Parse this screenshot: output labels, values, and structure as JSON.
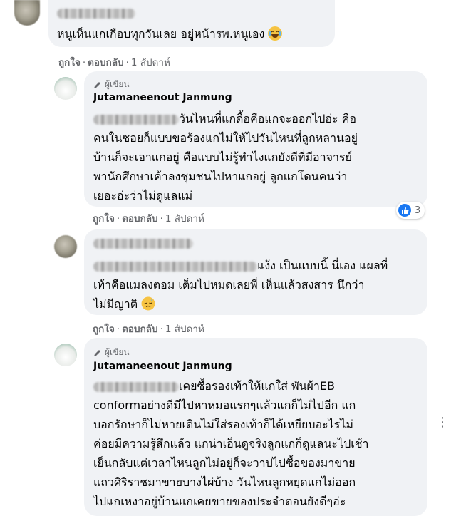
{
  "comments": [
    {
      "text": "หนูเห็นแกเกือบทุกวันเลย อยู่หน้ารพ.หนูเอง",
      "emoji": "laughing-crying-emoji",
      "actions": {
        "like": "ถูกใจ",
        "reply": "ตอบกลับ",
        "time": "1 สัปดาห์"
      }
    },
    {
      "badge": "ผู้เขียน",
      "author": "Jutamaneenout Janmung",
      "lines": [
        "วันไหนที่แกดื้อคือแกจะออกไปอ่ะ คือ",
        "คนในซอยก็แบบขอร้องแกไม่ให้ไปวันไหนที่ลูกหลานอยู่",
        "บ้านก็จะเอาแกอยู่ คือแบบไม่รู้ทำไงแกยังดีที่มีอาจารย์",
        "พานักศึกษาเค้าลงชุมชนไปหาแกอยู่ ลูกแกโดนคนว่า",
        "เยอะอ่ะว่าไม่ดูแลแม่"
      ],
      "reaction_count": "3",
      "actions": {
        "like": "ถูกใจ",
        "reply": "ตอบกลับ",
        "time": "1 สัปดาห์"
      }
    },
    {
      "lines": [
        "แง้ง เป็นแบบนี้ นี่เอง แผลที่",
        "เท้าคือแมลงตอม เต็มไปหมดเลยพี่ เห็นแล้วสงสาร นึกว่า",
        "ไม่มีญาติ"
      ],
      "emoji": "sad-sweat-emoji",
      "actions": {
        "like": "ถูกใจ",
        "reply": "ตอบกลับ",
        "time": "1 สัปดาห์"
      }
    },
    {
      "badge": "ผู้เขียน",
      "author": "Jutamaneenout Janmung",
      "lines": [
        "เคยซื้อรองเท้าให้แกใส่ พันผ้าEB",
        "conformอย่างดีมีไปหาหมอแรกๆแล้วแกก็ไม่ไปอีก แก",
        "บอกรักษาก็ไม่หายเดินไม่ใส่รองเท้าก็ได้เหยียบอะไรไม่",
        "ค่อยมีความรู้สึกแล้ว แกน่าเอ็นดูจริงลูกแกก็ดูแลนะไปเช้า",
        "เย็นกลับแต่เวลาไหนลูกไม่อยู่ก็จะวาปไปซื้อของมาขาย",
        "แถวศิริราชมาขายบางไผ่บ้าง วันไหนลูกหยุดแกไม่ออก",
        "ไปแกเหงาอยู่บ้านแกเคยขายของประจำตอนยังดีๆอ่ะ"
      ]
    }
  ]
}
